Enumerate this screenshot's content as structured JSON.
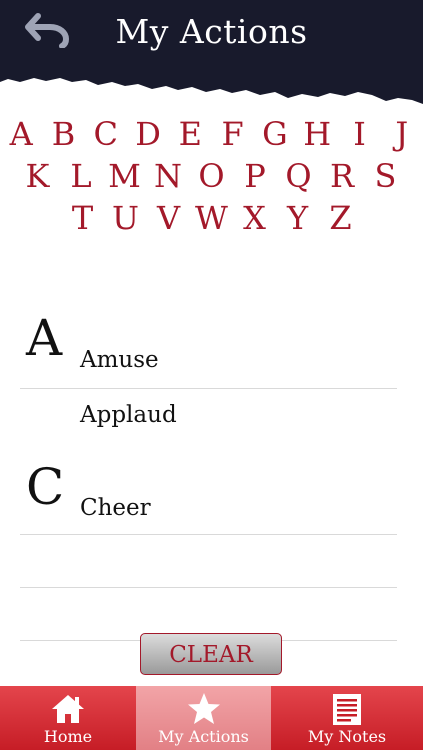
{
  "header": {
    "title": "My Actions",
    "back_icon": "undo-arrow-icon",
    "background_color": "#181a2c"
  },
  "alphabet": {
    "row1": [
      "A",
      "B",
      "C",
      "D",
      "E",
      "F",
      "G",
      "H",
      "I",
      "J"
    ],
    "row2": [
      "K",
      "L",
      "M",
      "N",
      "O",
      "P",
      "Q",
      "R",
      "S"
    ],
    "row3": [
      "T",
      "U",
      "V",
      "W",
      "X",
      "Y",
      "Z"
    ],
    "color": "#a3192a"
  },
  "list": {
    "rows": [
      {
        "section": "A",
        "label": "Amuse"
      },
      {
        "section": "",
        "label": "Applaud"
      },
      {
        "section": "C",
        "label": "Cheer"
      },
      {
        "section": "",
        "label": ""
      },
      {
        "section": "",
        "label": ""
      }
    ]
  },
  "clear_button": {
    "label": "CLEAR"
  },
  "tabbar": {
    "tabs": [
      {
        "label": "Home",
        "icon": "home-icon",
        "active": false
      },
      {
        "label": "My Actions",
        "icon": "star-icon",
        "active": true
      },
      {
        "label": "My Notes",
        "icon": "notes-icon",
        "active": false
      }
    ],
    "color": "#d42a32",
    "active_color": "#eb9094"
  }
}
